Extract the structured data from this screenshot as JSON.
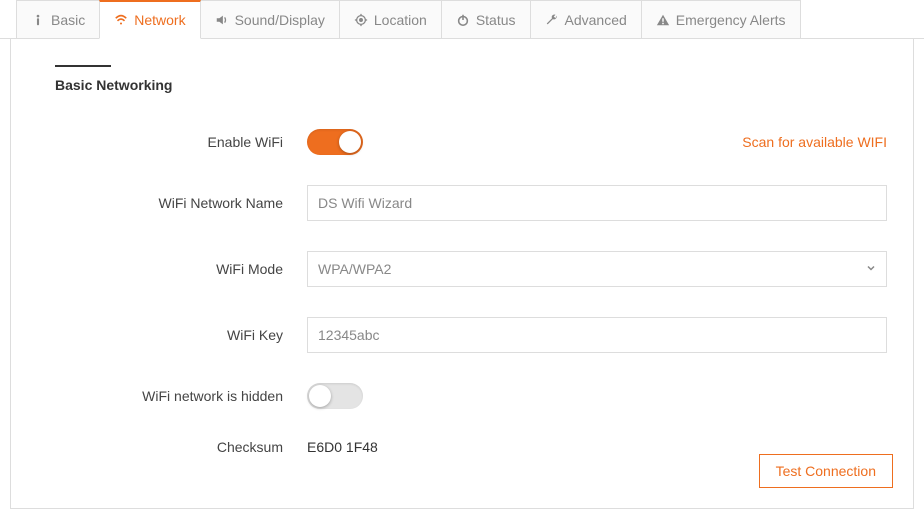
{
  "tabs": {
    "basic": "Basic",
    "network": "Network",
    "sound": "Sound/Display",
    "location": "Location",
    "status": "Status",
    "advanced": "Advanced",
    "emergency": "Emergency Alerts"
  },
  "section": {
    "title": "Basic Networking"
  },
  "form": {
    "enable_wifi_label": "Enable WiFi",
    "scan_link": "Scan for available WIFI",
    "wifi_name_label": "WiFi Network Name",
    "wifi_name_value": "DS Wifi Wizard",
    "wifi_mode_label": "WiFi Mode",
    "wifi_mode_value": "WPA/WPA2",
    "wifi_key_label": "WiFi Key",
    "wifi_key_value": "12345abc",
    "hidden_label": "WiFi network is hidden",
    "checksum_label": "Checksum",
    "checksum_value": "E6D0 1F48"
  },
  "buttons": {
    "test": "Test Connection"
  }
}
